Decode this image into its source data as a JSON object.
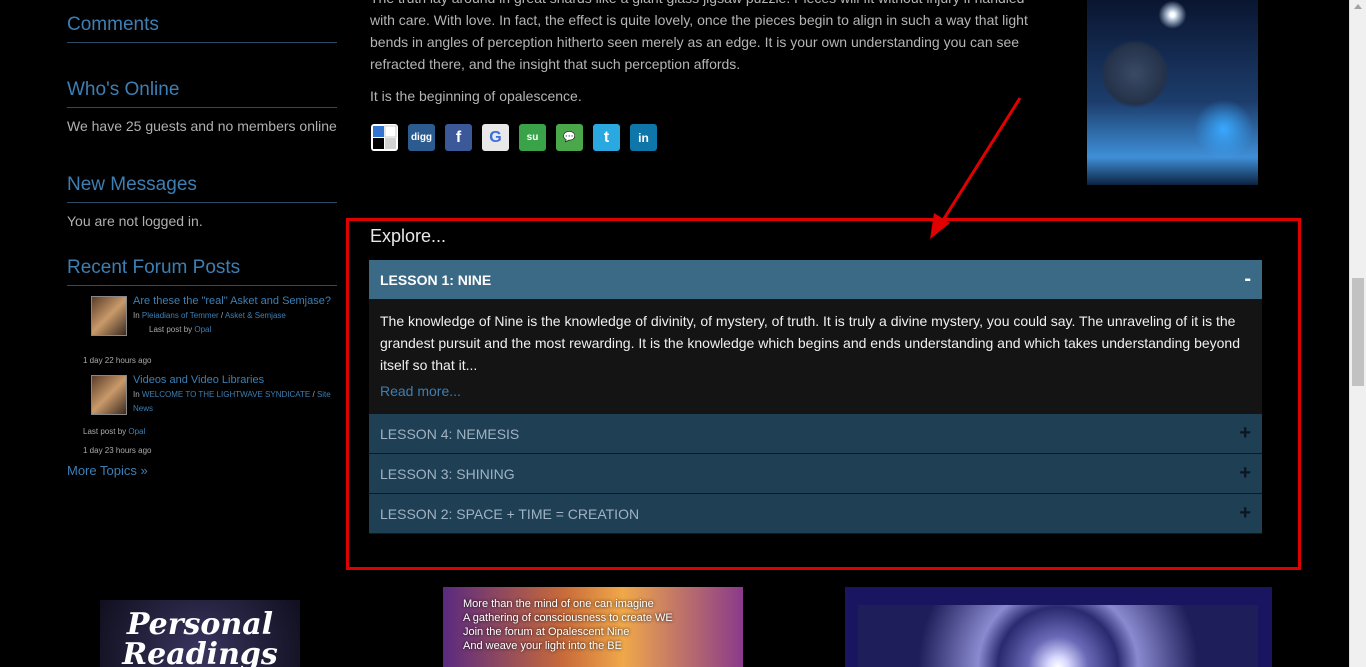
{
  "sidebar": {
    "comments_heading": "Comments",
    "whos_online_heading": "Who's Online",
    "whos_online_text": "We have 25 guests and no members online",
    "new_messages_heading": "New Messages",
    "new_messages_text": "You are not logged in.",
    "recent_posts_heading": "Recent Forum Posts",
    "posts": [
      {
        "title": "Are these the \"real\" Asket and Semjase?",
        "in_label": "In",
        "category": "Pleiadians of Temmer",
        "separator": "/",
        "subcategory": "Asket & Semjase",
        "last_post_by": "Last post by",
        "author": "Opal",
        "time": "1 day 22 hours ago"
      },
      {
        "title": "Videos and Video Libraries",
        "in_label": "In",
        "category": "WELCOME TO THE LIGHTWAVE SYNDICATE",
        "separator": "/",
        "subcategory": "Site News",
        "last_post_by": "Last post by",
        "author": "Opal",
        "time": "1 day 23 hours ago"
      }
    ],
    "more_topics": "More Topics »"
  },
  "article": {
    "para1": "The truth lay around in great shards like a giant glass jigsaw puzzle. Pieces will fit without injury if handled with care. With love. In fact, the effect is quite lovely, once the pieces begin to align in such a way that light bends in angles of perception hitherto seen merely as an edge. It is your own understanding you can see refracted there, and the insight that such perception affords.",
    "para2": "It is the beginning of opalescence."
  },
  "share_icons": [
    {
      "name": "delicious-icon",
      "label": "",
      "color": "#2a2a2a"
    },
    {
      "name": "digg-icon",
      "label": "digg",
      "color": "#2b5b8f"
    },
    {
      "name": "facebook-icon",
      "label": "f",
      "color": "#3b5998"
    },
    {
      "name": "google-icon",
      "label": "G",
      "color": "#e8e8e8"
    },
    {
      "name": "stumbleupon-icon",
      "label": "su",
      "color": "#3aa34a"
    },
    {
      "name": "technorati-icon",
      "label": "💬",
      "color": "#4aa84a"
    },
    {
      "name": "twitter-icon",
      "label": "t",
      "color": "#2aa9e0"
    },
    {
      "name": "linkedin-icon",
      "label": "in",
      "color": "#0e76a8"
    }
  ],
  "explore": {
    "title": "Explore...",
    "open_sign": "-",
    "closed_sign": "+",
    "lessons": [
      {
        "title": "LESSON 1: NINE"
      },
      {
        "title": "LESSON 4: NEMESIS"
      },
      {
        "title": "LESSON 3: SHINING"
      },
      {
        "title": "LESSON 2: SPACE + TIME = CREATION"
      }
    ],
    "open_body": "The knowledge of Nine is the knowledge of divinity, of mystery, of truth. It is truly a divine mystery, you could say. The unraveling of it is the grandest pursuit and the most rewarding. It is the knowledge which begins and ends understanding and which takes understanding beyond itself so that it...",
    "read_more": "Read more..."
  },
  "banners": {
    "readings_line1": "Personal",
    "readings_line2": "Readings",
    "forum_lines": [
      "More than the mind of one can imagine",
      "A gathering of consciousness to create WE",
      "Join the forum at Opalescent Nine",
      "And weave your light into the BE"
    ]
  },
  "colors": {
    "accent": "#3d7fb3",
    "annotation": "#e00000",
    "accordion_open": "#3a6a86",
    "accordion_closed": "#1f3f55"
  }
}
